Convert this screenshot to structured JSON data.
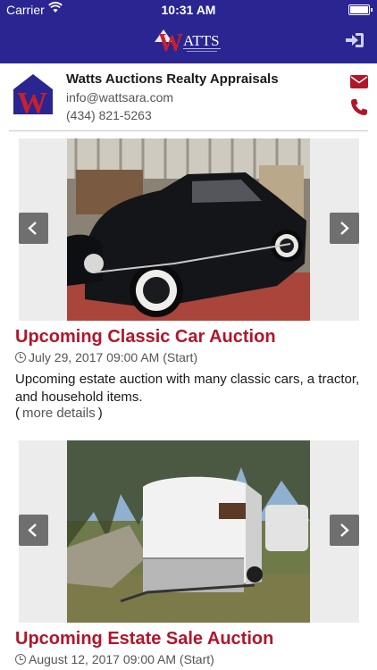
{
  "status": {
    "carrier": "Carrier",
    "time": "10:31 AM"
  },
  "header": {
    "logo_text": "WATTS",
    "icons": {
      "logout": "sign-in-icon"
    }
  },
  "contact": {
    "company": "Watts Auctions Realty Appraisals",
    "email": "info@wattsara.com",
    "phone": "(434) 821-5263",
    "icons": {
      "mail": "envelope-icon",
      "call": "phone-icon"
    }
  },
  "listings": [
    {
      "title": "Upcoming Classic Car Auction",
      "date": "July 29, 2017 09:00 AM (Start)",
      "description": "Upcoming estate auction with many classic cars, a tractor, and household items.",
      "more_open": "(",
      "more_label": "more details",
      "more_close": ")"
    },
    {
      "title": "Upcoming Estate Sale Auction",
      "date": "August 12, 2017 09:00 AM (Start)"
    }
  ],
  "colors": {
    "nav": "#2a2590",
    "accent": "#b0162a",
    "arrow_bg": "#6f6f6f"
  }
}
